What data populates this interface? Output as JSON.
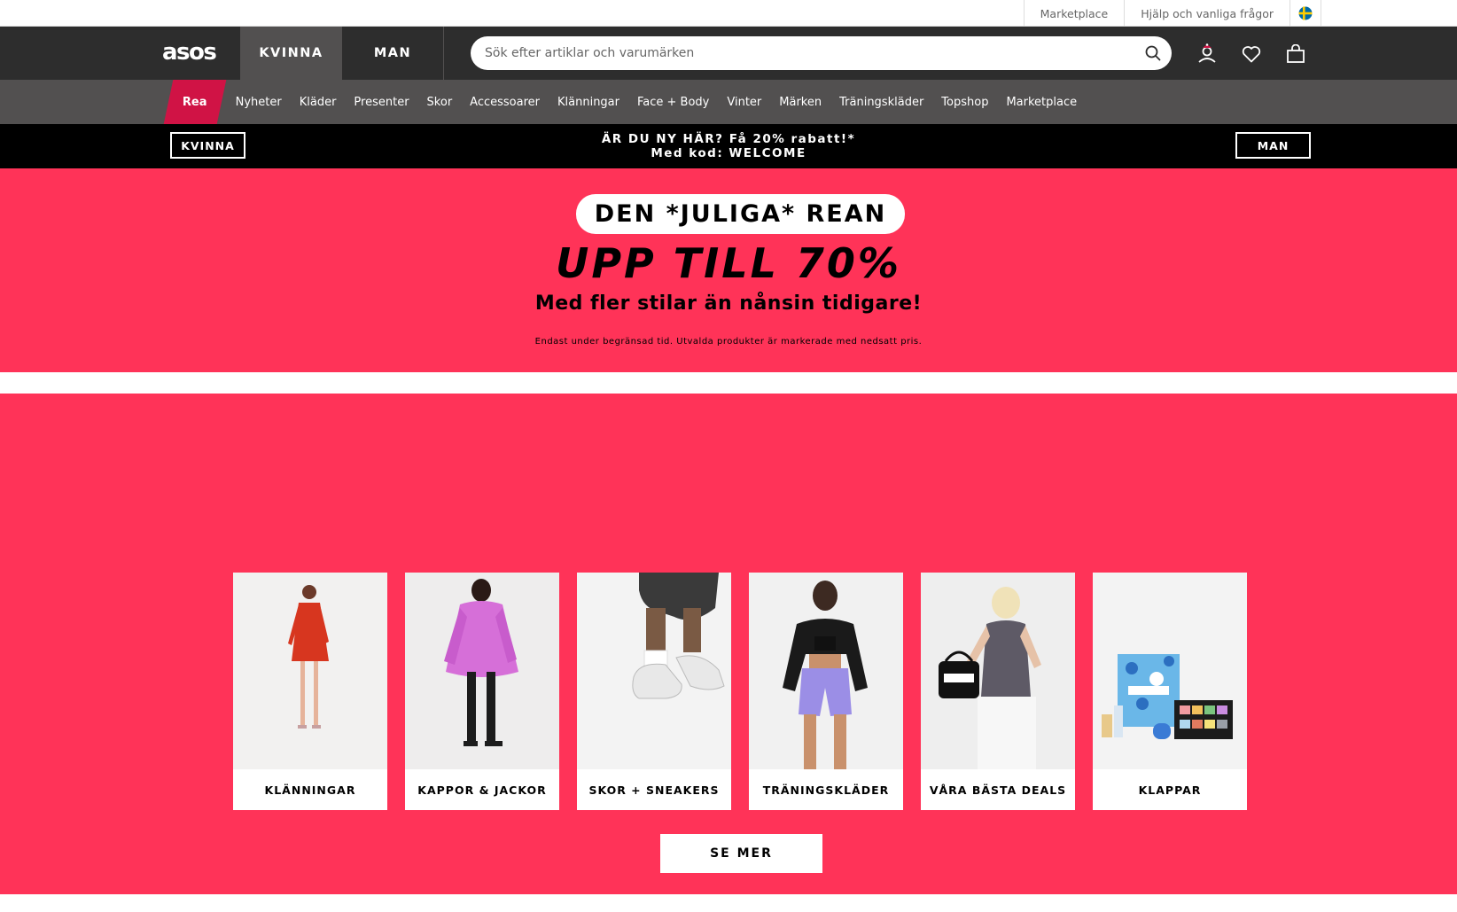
{
  "utility": {
    "links": [
      "Marketplace",
      "Hjälp och vanliga frågor"
    ],
    "country_flag_icon": "sweden-flag-icon"
  },
  "header": {
    "logo_text": "asos",
    "tabs": [
      "KVINNA",
      "MAN"
    ],
    "active_tab": "KVINNA",
    "search": {
      "placeholder": "Sök efter artiklar och varumärken",
      "value": ""
    },
    "icons": [
      "search-icon",
      "account-icon",
      "heart-icon",
      "bag-icon"
    ]
  },
  "category_nav": {
    "items": [
      "Rea",
      "Nyheter",
      "Kläder",
      "Presenter",
      "Skor",
      "Accessoarer",
      "Klänningar",
      "Face + Body",
      "Vinter",
      "Märken",
      "Träningskläder",
      "Topshop",
      "Marketplace"
    ]
  },
  "promo": {
    "left_button": "KVINNA",
    "right_button": "MAN",
    "line1": "ÄR DU NY HÄR? Få 20% rabatt!*",
    "line2": "Med kod: WELCOME"
  },
  "hero": {
    "pill": "DEN *JULIGA* REAN",
    "title": "UPP TILL 70%",
    "subtitle": "Med fler stilar än nånsin tidigare!",
    "fineprint": "Endast under begränsad tid. Utvalda produkter är markerade med nedsatt pris."
  },
  "categories": {
    "cards": [
      {
        "label": "KLÄNNINGAR"
      },
      {
        "label": "KAPPOR & JACKOR"
      },
      {
        "label": "SKOR + SNEAKERS"
      },
      {
        "label": "TRÄNINGSKLÄDER"
      },
      {
        "label": "VÅRA BÄSTA DEALS"
      },
      {
        "label": "KLAPPAR"
      }
    ],
    "see_more": "SE MER"
  },
  "colors": {
    "header": "#2d2d2d",
    "nav": "#525050",
    "sale": "#d01345",
    "hero": "#ff3358"
  }
}
